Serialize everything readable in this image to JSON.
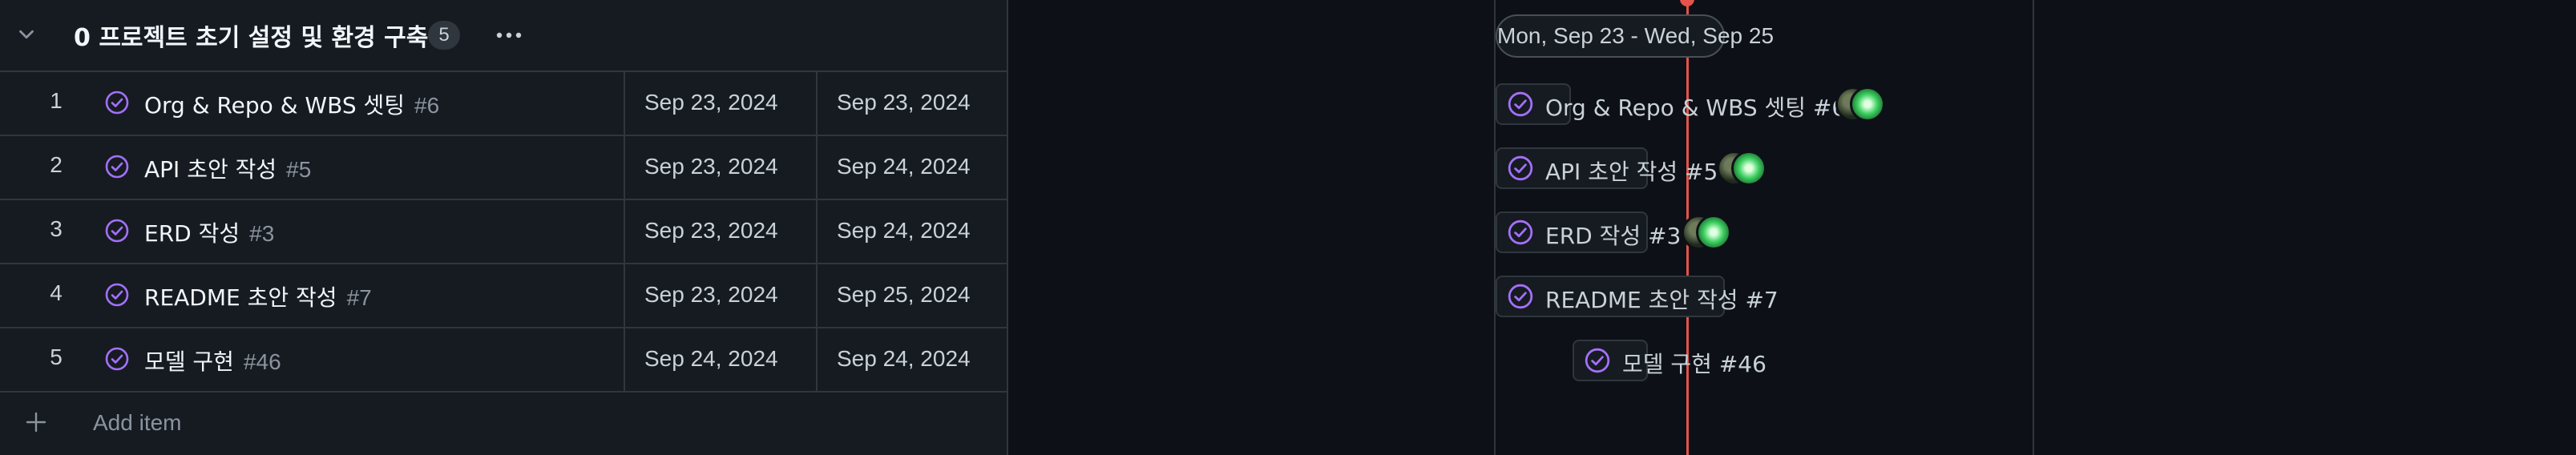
{
  "group": {
    "title": "0 프로젝트 초기 설정 및 환경 구축",
    "count": "5"
  },
  "rows": [
    {
      "num": "1",
      "title": "Org & Repo & WBS 셋팅",
      "issue": "#6",
      "start": "Sep 23, 2024",
      "end": "Sep 23, 2024"
    },
    {
      "num": "2",
      "title": "API 초안 작성",
      "issue": "#5",
      "start": "Sep 23, 2024",
      "end": "Sep 24, 2024"
    },
    {
      "num": "3",
      "title": "ERD 작성",
      "issue": "#3",
      "start": "Sep 23, 2024",
      "end": "Sep 24, 2024"
    },
    {
      "num": "4",
      "title": "README 초안 작성",
      "issue": "#7",
      "start": "Sep 23, 2024",
      "end": "Sep 25, 2024"
    },
    {
      "num": "5",
      "title": "모델 구현",
      "issue": "#46",
      "start": "Sep 24, 2024",
      "end": "Sep 24, 2024"
    }
  ],
  "add_item_label": "Add item",
  "timeline": {
    "range_label": "Mon, Sep 23 - Wed, Sep 25",
    "bars": [
      {
        "label": "Org & Repo & WBS 셋팅 #6"
      },
      {
        "label": "API 초안 작성 #5"
      },
      {
        "label": "ERD 작성 #3"
      },
      {
        "label": "README 초안 작성 #7"
      },
      {
        "label": "모델 구현 #46"
      }
    ]
  },
  "colors": {
    "background": "#0d1117",
    "status_purple": "#a371f7",
    "today_line": "#e5534b"
  },
  "icons": {
    "collapse": "chevron-down-icon",
    "status": "check-circle-icon",
    "more": "kebab-icon",
    "add": "plus-icon"
  }
}
